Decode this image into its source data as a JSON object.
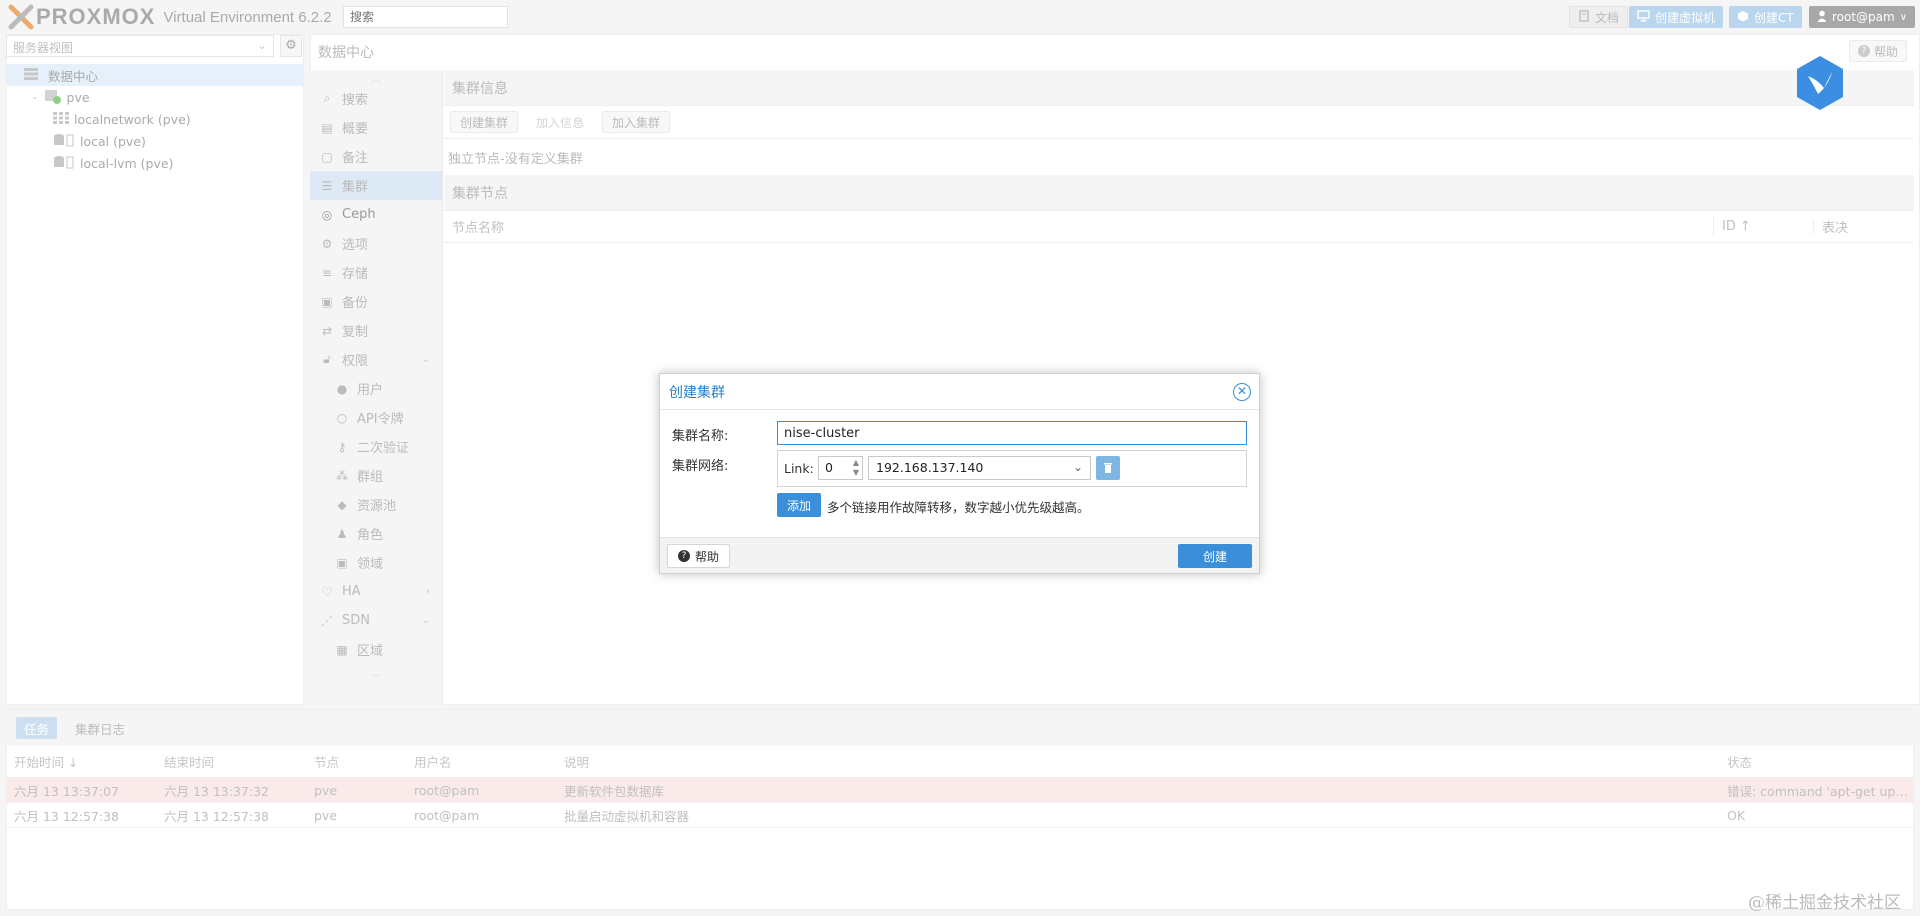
{
  "header": {
    "logo_word": "PROXMOX",
    "product": "Virtual Environment 6.2.2",
    "search_placeholder": "搜索",
    "docs_label": "文档",
    "create_vm_label": "创建虚拟机",
    "create_ct_label": "创建CT",
    "user_label": "root@pam"
  },
  "tree": {
    "view_label": "服务器视图",
    "items": [
      {
        "label": "数据中心",
        "icon": "datacenter-icon"
      },
      {
        "label": "pve",
        "icon": "node-icon"
      },
      {
        "label": "localnetwork (pve)",
        "icon": "network-icon"
      },
      {
        "label": "local (pve)",
        "icon": "storage-icon"
      },
      {
        "label": "local-lvm (pve)",
        "icon": "storage-icon"
      }
    ]
  },
  "main": {
    "title": "数据中心",
    "help_label": "帮助",
    "nav": [
      {
        "label": "搜索",
        "icon": "search-icon"
      },
      {
        "label": "概要",
        "icon": "summary-icon"
      },
      {
        "label": "备注",
        "icon": "notes-icon"
      },
      {
        "label": "集群",
        "icon": "cluster-icon",
        "selected": true
      },
      {
        "label": "Ceph",
        "icon": "ceph-icon"
      },
      {
        "label": "选项",
        "icon": "gear-icon"
      },
      {
        "label": "存储",
        "icon": "database-icon"
      },
      {
        "label": "备份",
        "icon": "save-icon"
      },
      {
        "label": "复制",
        "icon": "replication-icon"
      },
      {
        "label": "权限",
        "icon": "unlock-icon",
        "expandable": true
      },
      {
        "label": "用户",
        "icon": "user-icon",
        "sub": true
      },
      {
        "label": "API令牌",
        "icon": "token-icon",
        "sub": true
      },
      {
        "label": "二次验证",
        "icon": "key-icon",
        "sub": true
      },
      {
        "label": "群组",
        "icon": "group-icon",
        "sub": true
      },
      {
        "label": "资源池",
        "icon": "tags-icon",
        "sub": true
      },
      {
        "label": "角色",
        "icon": "role-icon",
        "sub": true
      },
      {
        "label": "领域",
        "icon": "realm-icon",
        "sub": true
      },
      {
        "label": "HA",
        "icon": "heartbeat-icon",
        "expandable": true
      },
      {
        "label": "SDN",
        "icon": "sdn-icon",
        "expandable": true
      },
      {
        "label": "区域",
        "icon": "zone-icon",
        "sub": true
      }
    ],
    "cluster_info": {
      "title": "集群信息",
      "buttons": {
        "create": "创建集群",
        "join_info": "加入信息",
        "join": "加入集群"
      },
      "status": "独立节点-没有定义集群"
    },
    "cluster_nodes": {
      "title": "集群节点",
      "columns": {
        "name": "节点名称",
        "id": "ID ↑",
        "votes": "表决"
      }
    }
  },
  "dialog": {
    "title": "创建集群",
    "name_label": "集群名称:",
    "name_value": "nise-cluster",
    "network_label": "集群网络:",
    "link_label": "Link:",
    "link_value": "0",
    "ip_value": "192.168.137.140",
    "add_label": "添加",
    "add_hint": "多个链接用作故障转移，数字越小优先级越高。",
    "help_label": "帮助",
    "create_label": "创建"
  },
  "tasks": {
    "tabs": [
      "任务",
      "集群日志"
    ],
    "columns": [
      "开始时间 ↓",
      "结束时间",
      "节点",
      "用户名",
      "说明",
      "状态"
    ],
    "rows": [
      [
        "六月 13 13:37:07",
        "六月 13 13:37:32",
        "pve",
        "root@pam",
        "更新软件包数据库",
        "错误: command 'apt-get upd..."
      ],
      [
        "六月 13 12:57:38",
        "六月 13 12:57:38",
        "pve",
        "root@pam",
        "批量启动虚拟机和容器",
        "OK"
      ]
    ]
  },
  "watermark": "@稀土掘金技术社区",
  "colors": {
    "accent": "#3a8fd8",
    "logo_orange": "#e57000",
    "error_row": "#fbeaea"
  }
}
